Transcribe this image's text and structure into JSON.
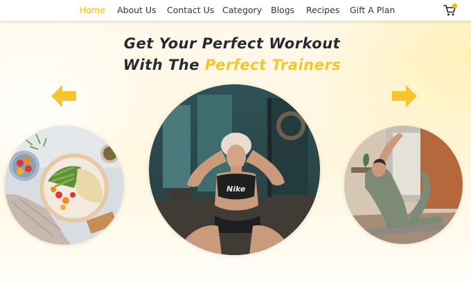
{
  "nav": {
    "items": [
      {
        "label": "Home",
        "active": true
      },
      {
        "label": "About Us",
        "active": false
      },
      {
        "label": "Contact Us",
        "active": false
      },
      {
        "label": "Category",
        "active": false
      },
      {
        "label": "Blogs",
        "active": false
      },
      {
        "label": "Recipes",
        "active": false
      },
      {
        "label": "Gift A Plan",
        "active": false
      }
    ],
    "cart_icon": "shopping-cart-icon"
  },
  "hero": {
    "line1": "Get Your Perfect Workout",
    "line2_prefix": "With The",
    "line2_accent": "Perfect Trainers"
  },
  "carousel": {
    "prev_icon": "arrow-left-icon",
    "next_icon": "arrow-right-icon",
    "slides": [
      {
        "name": "healthy-food-bowl"
      },
      {
        "name": "woman-doing-situps",
        "shirt_text": "Nike"
      },
      {
        "name": "woman-doing-yoga"
      }
    ]
  },
  "colors": {
    "accent": "#f5b800",
    "heading": "#262b33",
    "nav_text": "#333333"
  }
}
